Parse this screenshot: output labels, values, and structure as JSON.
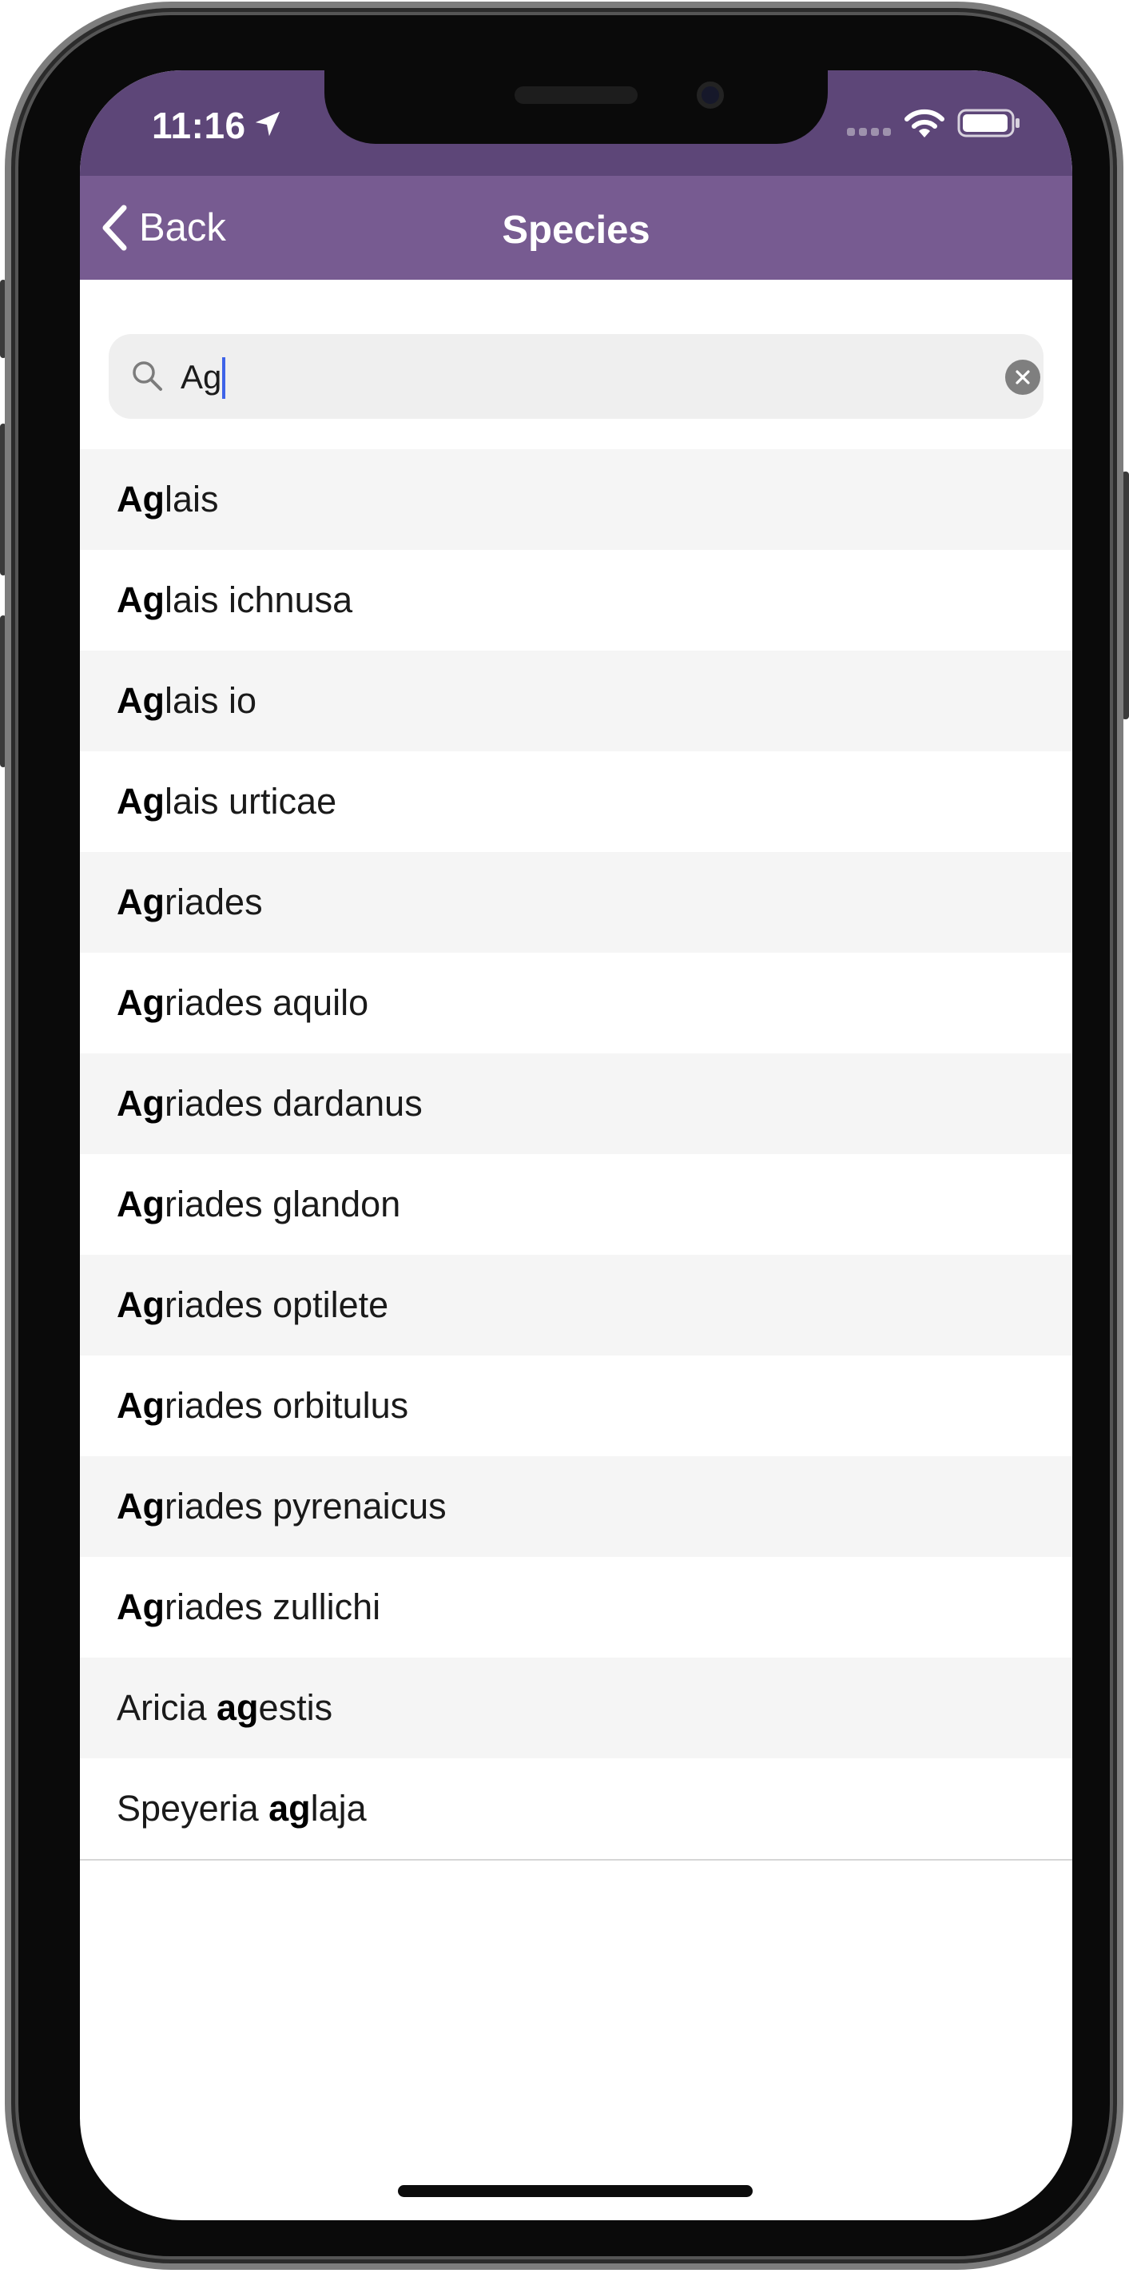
{
  "status_bar": {
    "time": "11:16",
    "icons": [
      "location-arrow-icon",
      "cellular-signal-icon",
      "wifi-icon",
      "battery-icon"
    ]
  },
  "nav": {
    "back_label": "Back",
    "title": "Species",
    "background_color": "#775b91"
  },
  "search": {
    "value": "Ag",
    "icons": [
      "search-icon",
      "clear-icon"
    ]
  },
  "results": [
    {
      "pre": "",
      "match": "Ag",
      "post": "lais"
    },
    {
      "pre": "",
      "match": "Ag",
      "post": "lais ichnusa"
    },
    {
      "pre": "",
      "match": "Ag",
      "post": "lais io"
    },
    {
      "pre": "",
      "match": "Ag",
      "post": "lais urticae"
    },
    {
      "pre": "",
      "match": "Ag",
      "post": "riades"
    },
    {
      "pre": "",
      "match": "Ag",
      "post": "riades aquilo"
    },
    {
      "pre": "",
      "match": "Ag",
      "post": "riades dardanus"
    },
    {
      "pre": "",
      "match": "Ag",
      "post": "riades glandon"
    },
    {
      "pre": "",
      "match": "Ag",
      "post": "riades optilete"
    },
    {
      "pre": "",
      "match": "Ag",
      "post": "riades orbitulus"
    },
    {
      "pre": "",
      "match": "Ag",
      "post": "riades pyrenaicus"
    },
    {
      "pre": "",
      "match": "Ag",
      "post": "riades zullichi"
    },
    {
      "pre": "Aricia ",
      "match": "ag",
      "post": "estis"
    },
    {
      "pre": "Speyeria ",
      "match": "ag",
      "post": "laja"
    }
  ]
}
